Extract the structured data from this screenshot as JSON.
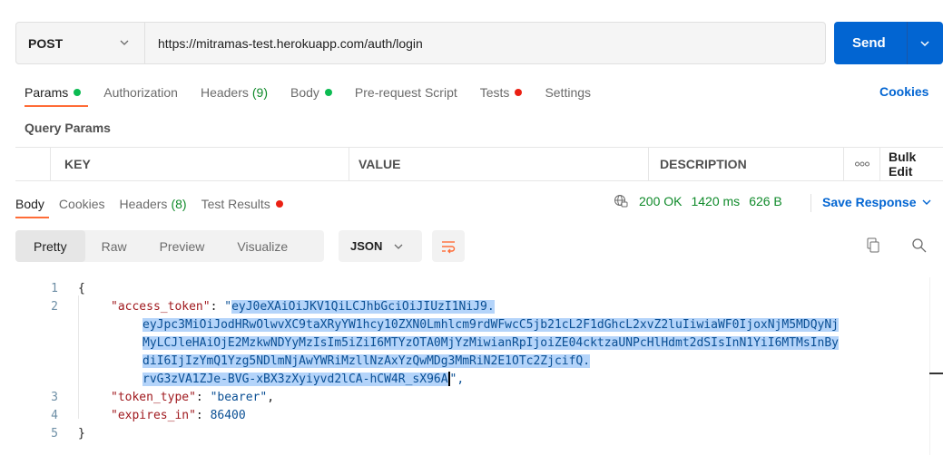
{
  "request": {
    "method": "POST",
    "url": "https://mitramas-test.herokuapp.com/auth/login",
    "send_label": "Send"
  },
  "request_tabs": [
    {
      "label": "Params",
      "dot": "green"
    },
    {
      "label": "Authorization"
    },
    {
      "label": "Headers",
      "count": "(9)"
    },
    {
      "label": "Body",
      "dot": "green"
    },
    {
      "label": "Pre-request Script"
    },
    {
      "label": "Tests",
      "dot": "red"
    },
    {
      "label": "Settings"
    }
  ],
  "cookies_label": "Cookies",
  "query_params_label": "Query Params",
  "params_table": {
    "key": "KEY",
    "value": "VALUE",
    "description": "DESCRIPTION",
    "more": "ooo",
    "bulk_edit": "Bulk Edit"
  },
  "response_tabs": [
    {
      "label": "Body"
    },
    {
      "label": "Cookies"
    },
    {
      "label": "Headers",
      "count": "(8)"
    },
    {
      "label": "Test Results",
      "dot": "red"
    }
  ],
  "response_status": {
    "code": "200 OK",
    "time": "1420 ms",
    "size": "626 B",
    "save_label": "Save Response"
  },
  "view_modes": [
    "Pretty",
    "Raw",
    "Preview",
    "Visualize"
  ],
  "format": "JSON",
  "code_lines": {
    "l1": {
      "num": "1",
      "text": "{"
    },
    "l2": {
      "num": "2",
      "key": "\"access_token\"",
      "sep": ": ",
      "q": "\"",
      "t1": "eyJ0eXAiOiJKV1QiLCJhbGciOiJIUzI1NiJ9.",
      "t2": "eyJpc3MiOiJodHRwOlwvXC9taXRyYW1hcy10ZXN0Lmhlcm9rdWFwcC5jb21cL2F1dGhcL2xvZ2luIiwiaWF0IjoxNjM5MDQyNj",
      "t3": "MyLCJleHAiOjE2MzkwNDYyMzIsIm5iZiI6MTYzOTA0MjYzMiwianRpIjoiZE04cktzaUNPcHlHdmt2dSIsInN1YiI6MTMsInBy",
      "t4": "diI6IjIzYmQ1Yzg5NDlmNjAwYWRiMzllNzAxYzQwMDg3MmRiN2E1OTc2ZjcifQ.",
      "t5": "rvG3zVA1ZJe-BVG-xBX3zXyiyvd2lCA-hCW4R_sX96A",
      "end": "\","
    },
    "l3": {
      "num": "3",
      "key": "\"token_type\"",
      "sep": ": ",
      "val": "\"bearer\"",
      "end": ","
    },
    "l4": {
      "num": "4",
      "key": "\"expires_in\"",
      "sep": ": ",
      "val": "86400"
    },
    "l5": {
      "num": "5",
      "text": "}"
    }
  },
  "colors": {
    "accent": "#ff6c37",
    "send": "#0265d2",
    "ok": "#0f8a2a",
    "selection": "#b4d4fa"
  }
}
